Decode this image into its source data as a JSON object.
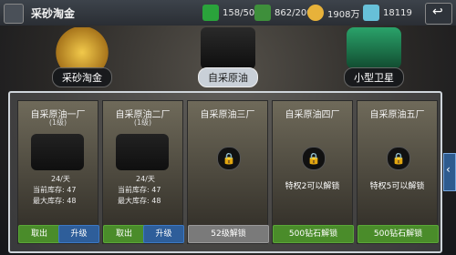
{
  "header": {
    "title": "采砂淘金",
    "resources": [
      {
        "value": "158/50",
        "color": "#2aa33b"
      },
      {
        "value": "862/200",
        "color": "#3e8f3b"
      },
      {
        "value": "1908万",
        "color": "#e7b23a"
      },
      {
        "value": "18119",
        "color": "#67c0d8"
      }
    ]
  },
  "categories": [
    {
      "label": "采砂淘金",
      "selected": false
    },
    {
      "label": "自采原油",
      "selected": true
    },
    {
      "label": "小型卫星",
      "selected": false
    }
  ],
  "cards": [
    {
      "title": "自采原油一厂",
      "level": "(1级)",
      "rate": "24/天",
      "stock_label": "当前库存: 47",
      "max_label": "最大库存: 48",
      "btn1": "取出",
      "btn2": "升级"
    },
    {
      "title": "自采原油二厂",
      "level": "(1级)",
      "rate": "24/天",
      "stock_label": "当前库存: 47",
      "max_label": "最大库存: 48",
      "btn1": "取出",
      "btn2": "升级"
    },
    {
      "title": "自采原油三厂",
      "req": "",
      "btn1": "52级解锁"
    },
    {
      "title": "自采原油四厂",
      "req": "特权2可以解锁",
      "btn1": "500钻石解锁"
    },
    {
      "title": "自采原油五厂",
      "req": "特权5可以解锁",
      "btn1": "500钻石解锁"
    }
  ]
}
